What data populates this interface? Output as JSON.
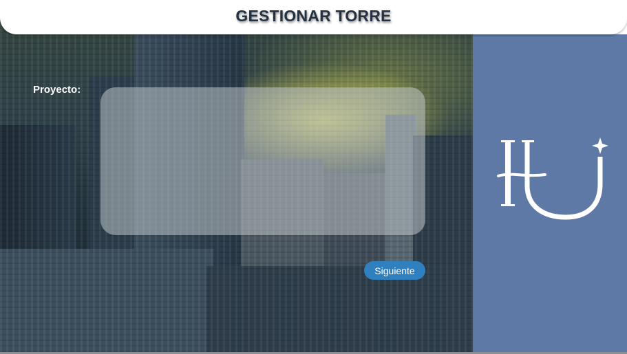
{
  "header": {
    "title": "GESTIONAR TORRE"
  },
  "form": {
    "project_label": "Proyecto:",
    "project_value": "",
    "next_button_label": "Siguiente"
  },
  "colors": {
    "side_panel": "#5e79a6",
    "button": "#2f80bf",
    "title_text": "#233140"
  },
  "icons": {
    "logo": "hu-monogram-logo"
  }
}
